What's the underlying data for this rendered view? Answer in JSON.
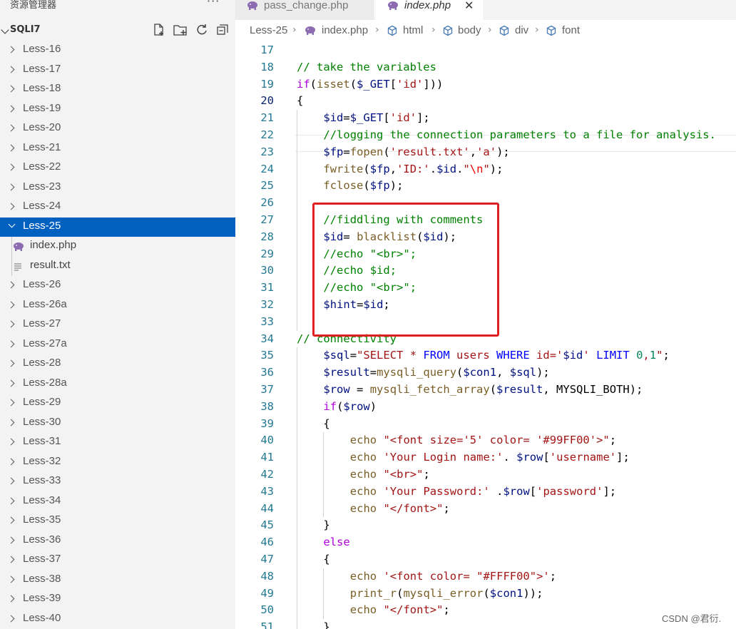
{
  "explorer": {
    "title": "资源管理器",
    "more_label": "···",
    "folder_name": "SQLI7",
    "actions": [
      "new-file-icon",
      "new-folder-icon",
      "refresh-icon",
      "collapse-all-icon"
    ],
    "items_before": [
      "Less-16",
      "Less-17",
      "Less-18",
      "Less-19",
      "Less-20",
      "Less-21",
      "Less-22",
      "Less-23",
      "Less-24"
    ],
    "selected_folder": "Less-25",
    "selected_children": [
      "index.php",
      "result.txt"
    ],
    "items_after": [
      "Less-26",
      "Less-26a",
      "Less-27",
      "Less-27a",
      "Less-28",
      "Less-28a",
      "Less-29",
      "Less-30",
      "Less-31",
      "Less-32",
      "Less-33",
      "Less-34",
      "Less-35",
      "Less-36",
      "Less-37",
      "Less-38",
      "Less-39",
      "Less-40"
    ]
  },
  "tabs": [
    {
      "label": "pass_change.php",
      "active": false
    },
    {
      "label": "index.php",
      "active": true
    }
  ],
  "tab_close_label": "✕",
  "breadcrumb": [
    "Less-25",
    "index.php",
    "html",
    "body",
    "div",
    "font"
  ],
  "editor": {
    "active_line": 20,
    "lines": [
      {
        "n": 17,
        "indent": 0,
        "tokens": []
      },
      {
        "n": 18,
        "indent": 0,
        "tokens": [
          [
            "cm",
            "// take the variables"
          ]
        ]
      },
      {
        "n": 19,
        "indent": 0,
        "tokens": [
          [
            "ctl",
            "if"
          ],
          [
            "pl",
            "("
          ],
          [
            "fn",
            "isset"
          ],
          [
            "pl",
            "("
          ],
          [
            "var",
            "$_GET"
          ],
          [
            "pl",
            "["
          ],
          [
            "str",
            "'id'"
          ],
          [
            "pl",
            "]))"
          ]
        ]
      },
      {
        "n": 20,
        "indent": 0,
        "tokens": [
          [
            "pl",
            "{"
          ]
        ]
      },
      {
        "n": 21,
        "indent": 1,
        "tokens": [
          [
            "var",
            "$id"
          ],
          [
            "pl",
            "="
          ],
          [
            "var",
            "$_GET"
          ],
          [
            "pl",
            "["
          ],
          [
            "str",
            "'id'"
          ],
          [
            "pl",
            "];"
          ]
        ]
      },
      {
        "n": 22,
        "indent": 1,
        "tokens": [
          [
            "cm",
            "//logging the connection parameters to a file for analysis."
          ]
        ]
      },
      {
        "n": 23,
        "indent": 1,
        "tokens": [
          [
            "var",
            "$fp"
          ],
          [
            "pl",
            "="
          ],
          [
            "fn",
            "fopen"
          ],
          [
            "pl",
            "("
          ],
          [
            "str",
            "'result.txt'"
          ],
          [
            "pl",
            ","
          ],
          [
            "str",
            "'a'"
          ],
          [
            "pl",
            ");"
          ]
        ]
      },
      {
        "n": 24,
        "indent": 1,
        "tokens": [
          [
            "fn",
            "fwrite"
          ],
          [
            "pl",
            "("
          ],
          [
            "var",
            "$fp"
          ],
          [
            "pl",
            ","
          ],
          [
            "str",
            "'ID:'"
          ],
          [
            "pl",
            "."
          ],
          [
            "var",
            "$id"
          ],
          [
            "pl",
            "."
          ],
          [
            "str",
            "\""
          ],
          [
            "esc",
            "\\n"
          ],
          [
            "str",
            "\""
          ],
          [
            "pl",
            ");"
          ]
        ]
      },
      {
        "n": 25,
        "indent": 1,
        "tokens": [
          [
            "fn",
            "fclose"
          ],
          [
            "pl",
            "("
          ],
          [
            "var",
            "$fp"
          ],
          [
            "pl",
            ");"
          ]
        ]
      },
      {
        "n": 26,
        "indent": 1,
        "tokens": []
      },
      {
        "n": 27,
        "indent": 1,
        "tokens": [
          [
            "cm",
            "//fiddling with comments"
          ]
        ]
      },
      {
        "n": 28,
        "indent": 1,
        "tokens": [
          [
            "var",
            "$id"
          ],
          [
            "pl",
            "= "
          ],
          [
            "fn",
            "blacklist"
          ],
          [
            "pl",
            "("
          ],
          [
            "var",
            "$id"
          ],
          [
            "pl",
            ");"
          ]
        ]
      },
      {
        "n": 29,
        "indent": 1,
        "tokens": [
          [
            "cm",
            "//echo \"<br>\";"
          ]
        ]
      },
      {
        "n": 30,
        "indent": 1,
        "tokens": [
          [
            "cm",
            "//echo $id;"
          ]
        ]
      },
      {
        "n": 31,
        "indent": 1,
        "tokens": [
          [
            "cm",
            "//echo \"<br>\";"
          ]
        ]
      },
      {
        "n": 32,
        "indent": 1,
        "tokens": [
          [
            "var",
            "$hint"
          ],
          [
            "pl",
            "="
          ],
          [
            "var",
            "$id"
          ],
          [
            "pl",
            ";"
          ]
        ]
      },
      {
        "n": 33,
        "indent": 1,
        "tokens": []
      },
      {
        "n": 34,
        "indent": 0,
        "tokens": [
          [
            "cm",
            "// connectivity"
          ]
        ]
      },
      {
        "n": 35,
        "indent": 1,
        "tokens": [
          [
            "var",
            "$sql"
          ],
          [
            "pl",
            "="
          ],
          [
            "str",
            "\"SELECT * "
          ],
          [
            "kw",
            "FROM"
          ],
          [
            "str",
            " users "
          ],
          [
            "kw",
            "WHERE"
          ],
          [
            "str",
            " id='"
          ],
          [
            "var",
            "$id"
          ],
          [
            "str",
            "' "
          ],
          [
            "kw",
            "LIMIT"
          ],
          [
            "str",
            " "
          ],
          [
            "num",
            "0"
          ],
          [
            "str",
            ","
          ],
          [
            "num",
            "1"
          ],
          [
            "str",
            "\""
          ],
          [
            "pl",
            ";"
          ]
        ]
      },
      {
        "n": 36,
        "indent": 1,
        "tokens": [
          [
            "var",
            "$result"
          ],
          [
            "pl",
            "="
          ],
          [
            "fn",
            "mysqli_query"
          ],
          [
            "pl",
            "("
          ],
          [
            "var",
            "$con1"
          ],
          [
            "pl",
            ", "
          ],
          [
            "var",
            "$sql"
          ],
          [
            "pl",
            ");"
          ]
        ]
      },
      {
        "n": 37,
        "indent": 1,
        "tokens": [
          [
            "var",
            "$row"
          ],
          [
            "pl",
            " = "
          ],
          [
            "fn",
            "mysqli_fetch_array"
          ],
          [
            "pl",
            "("
          ],
          [
            "var",
            "$result"
          ],
          [
            "pl",
            ", MYSQLI_BOTH);"
          ]
        ]
      },
      {
        "n": 38,
        "indent": 1,
        "tokens": [
          [
            "ctl",
            "if"
          ],
          [
            "pl",
            "("
          ],
          [
            "var",
            "$row"
          ],
          [
            "pl",
            ")"
          ]
        ]
      },
      {
        "n": 39,
        "indent": 1,
        "tokens": [
          [
            "pl",
            "{"
          ]
        ]
      },
      {
        "n": 40,
        "indent": 2,
        "tokens": [
          [
            "fn",
            "echo"
          ],
          [
            "pl",
            " "
          ],
          [
            "str",
            "\"<font size='5' color= '#99FF00'>\""
          ],
          [
            "pl",
            ";"
          ]
        ]
      },
      {
        "n": 41,
        "indent": 2,
        "tokens": [
          [
            "fn",
            "echo"
          ],
          [
            "pl",
            " "
          ],
          [
            "str",
            "'Your Login name:'"
          ],
          [
            "pl",
            ". "
          ],
          [
            "var",
            "$row"
          ],
          [
            "pl",
            "["
          ],
          [
            "str",
            "'username'"
          ],
          [
            "pl",
            "];"
          ]
        ]
      },
      {
        "n": 42,
        "indent": 2,
        "tokens": [
          [
            "fn",
            "echo"
          ],
          [
            "pl",
            " "
          ],
          [
            "str",
            "\"<br>\""
          ],
          [
            "pl",
            ";"
          ]
        ]
      },
      {
        "n": 43,
        "indent": 2,
        "tokens": [
          [
            "fn",
            "echo"
          ],
          [
            "pl",
            " "
          ],
          [
            "str",
            "'Your Password:'"
          ],
          [
            "pl",
            " ."
          ],
          [
            "var",
            "$row"
          ],
          [
            "pl",
            "["
          ],
          [
            "str",
            "'password'"
          ],
          [
            "pl",
            "];"
          ]
        ]
      },
      {
        "n": 44,
        "indent": 2,
        "tokens": [
          [
            "fn",
            "echo"
          ],
          [
            "pl",
            " "
          ],
          [
            "str",
            "\"</font>\""
          ],
          [
            "pl",
            ";"
          ]
        ]
      },
      {
        "n": 45,
        "indent": 1,
        "tokens": [
          [
            "pl",
            "}"
          ]
        ]
      },
      {
        "n": 46,
        "indent": 1,
        "tokens": [
          [
            "ctl",
            "else"
          ]
        ]
      },
      {
        "n": 47,
        "indent": 1,
        "tokens": [
          [
            "pl",
            "{"
          ]
        ]
      },
      {
        "n": 48,
        "indent": 2,
        "tokens": [
          [
            "fn",
            "echo"
          ],
          [
            "pl",
            " "
          ],
          [
            "str",
            "'<font color= \"#FFFF00\">'"
          ],
          [
            "pl",
            ";"
          ]
        ]
      },
      {
        "n": 49,
        "indent": 2,
        "tokens": [
          [
            "fn",
            "print_r"
          ],
          [
            "pl",
            "("
          ],
          [
            "fn",
            "mysqli_error"
          ],
          [
            "pl",
            "("
          ],
          [
            "var",
            "$con1"
          ],
          [
            "pl",
            "));"
          ]
        ]
      },
      {
        "n": 50,
        "indent": 2,
        "tokens": [
          [
            "fn",
            "echo"
          ],
          [
            "pl",
            " "
          ],
          [
            "str",
            "\"</font>\""
          ],
          [
            "pl",
            ";"
          ]
        ]
      },
      {
        "n": 51,
        "indent": 1,
        "tokens": [
          [
            "pl",
            "}"
          ]
        ]
      }
    ]
  },
  "watermark": "CSDN @君衍.",
  "colors": {
    "selection": "#0060c0",
    "highlight_box": "#e02020",
    "comment": "#008000",
    "keyword": "#0000ff",
    "control": "#af00db",
    "variable": "#001080",
    "function": "#795e26",
    "string": "#a31515",
    "php_icon": "#8c6bb1"
  }
}
